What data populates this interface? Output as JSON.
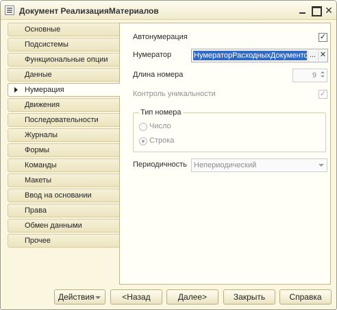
{
  "window": {
    "title": "Документ РеализацияМатериалов",
    "min_label": "",
    "close_label": "✕"
  },
  "tabs": [
    {
      "label": "Основные",
      "active": false
    },
    {
      "label": "Подсистемы",
      "active": false
    },
    {
      "label": "Функциональные опции",
      "active": false
    },
    {
      "label": "Данные",
      "active": false
    },
    {
      "label": "Нумерация",
      "active": true
    },
    {
      "label": "Движения",
      "active": false
    },
    {
      "label": "Последовательности",
      "active": false
    },
    {
      "label": "Журналы",
      "active": false
    },
    {
      "label": "Формы",
      "active": false
    },
    {
      "label": "Команды",
      "active": false
    },
    {
      "label": "Макеты",
      "active": false
    },
    {
      "label": "Ввод на основании",
      "active": false
    },
    {
      "label": "Права",
      "active": false
    },
    {
      "label": "Обмен данными",
      "active": false
    },
    {
      "label": "Прочее",
      "active": false
    }
  ],
  "numbering": {
    "autonumbering_label": "Автонумерация",
    "autonumbering_checked": true,
    "numerator_label": "Нумератор",
    "numerator_value": "НумераторРасходныхДокументов",
    "numerator_choose": "...",
    "numerator_clear": "✕",
    "length_label": "Длина номера",
    "length_value": "9",
    "uniqueness_label": "Контроль уникальности",
    "uniqueness_checked": true,
    "number_type_title": "Тип номера",
    "number_type_options": [
      "Число",
      "Строка"
    ],
    "number_type_selected": "Строка",
    "periodicity_label": "Периодичность",
    "periodicity_value": "Непериодический"
  },
  "buttons": {
    "actions": "Действия",
    "back": "<Назад",
    "next": "Далее>",
    "close": "Закрыть",
    "help": "Справка"
  },
  "check_glyph": "✓"
}
